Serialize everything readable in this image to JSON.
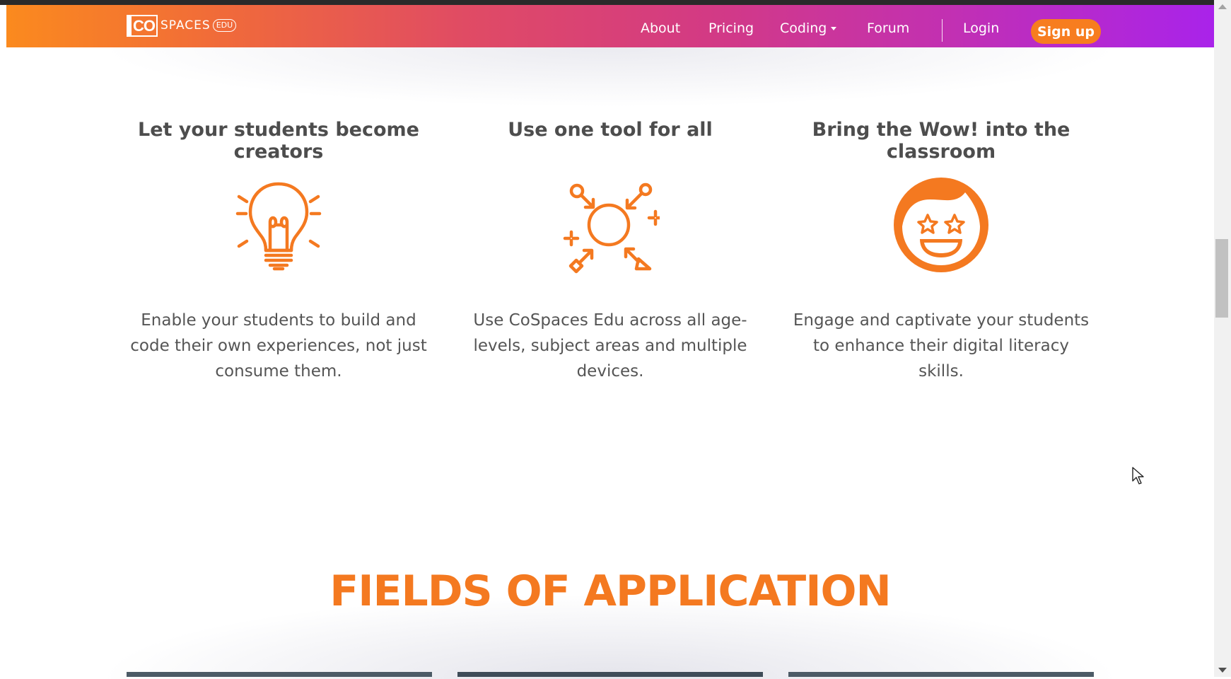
{
  "colors": {
    "accent": "#f47920",
    "nav_start": "#fb8a1e",
    "nav_end": "#a923ea",
    "signup_bg": "#f77d1f"
  },
  "header": {
    "logo": {
      "box_text": "CO",
      "word": "SPACES",
      "badge": "EDU"
    },
    "nav": {
      "about": "About",
      "pricing": "Pricing",
      "coding": "Coding",
      "forum": "Forum",
      "login": "Login",
      "signup": "Sign up"
    }
  },
  "features": [
    {
      "title_line1": "Let your students become",
      "title_line2": "creators",
      "icon": "lightbulb-icon",
      "text_line1": "Enable your students to build and",
      "text_line2": "code their own experiences, not just",
      "text_line3": "consume them."
    },
    {
      "title_line1": "Use one tool for all",
      "title_line2": "",
      "icon": "multi-tool-icon",
      "text_line1": "Use CoSpaces Edu across all age-",
      "text_line2": "levels, subject areas and multiple",
      "text_line3": "devices."
    },
    {
      "title_line1": "Bring the Wow! into the",
      "title_line2": "classroom",
      "icon": "star-eyes-face-icon",
      "text_line1": "Engage and captivate your students",
      "text_line2": "to enhance their digital literacy",
      "text_line3": "skills."
    }
  ],
  "fields": {
    "heading": "FIELDS OF APPLICATION"
  }
}
